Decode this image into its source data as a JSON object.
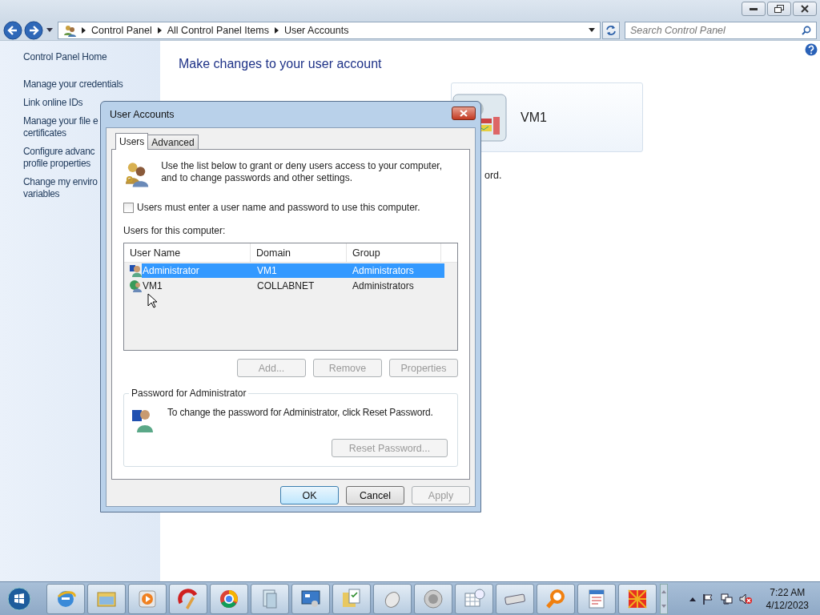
{
  "address_bar": {
    "breadcrumbs": [
      "Control Panel",
      "All Control Panel Items",
      "User Accounts"
    ]
  },
  "search": {
    "placeholder": "Search Control Panel"
  },
  "sidebar": {
    "home": "Control Panel Home",
    "links": [
      {
        "lines": [
          "Manage your credentials"
        ]
      },
      {
        "lines": [
          "Link online IDs"
        ]
      },
      {
        "lines": [
          "Manage your file e",
          "certificates"
        ]
      },
      {
        "lines": [
          "Configure advanc",
          "profile properties"
        ]
      },
      {
        "lines": [
          "Change my enviro",
          "variables"
        ]
      }
    ]
  },
  "content": {
    "heading": "Make changes to your user account",
    "account_name": "VM1",
    "fragment": "ord."
  },
  "dialog": {
    "title": "User Accounts",
    "tabs": [
      {
        "label": "Users",
        "selected": true
      },
      {
        "label": "Advanced",
        "selected": false
      }
    ],
    "intro": "Use the list below to grant or deny users access to your computer, and to change passwords and other settings.",
    "require_login": {
      "label": "Users must enter a user name and password to use this computer.",
      "checked": false
    },
    "list_label": "Users for this computer:",
    "table": {
      "columns": [
        "User Name",
        "Domain",
        "Group"
      ],
      "rows": [
        {
          "cells": [
            "Administrator",
            "VM1",
            "Administrators"
          ],
          "selected": true
        },
        {
          "cells": [
            "VM1",
            "COLLABNET",
            "Administrators"
          ],
          "selected": false
        }
      ]
    },
    "list_buttons": [
      {
        "label": "Add...",
        "disabled": true
      },
      {
        "label": "Remove",
        "disabled": true
      },
      {
        "label": "Properties",
        "disabled": true
      }
    ],
    "password_group": {
      "title": "Password for Administrator",
      "text": "To change the password for Administrator, click Reset Password.",
      "button": {
        "label": "Reset Password...",
        "disabled": true
      }
    },
    "buttons": [
      {
        "label": "OK",
        "disabled": false
      },
      {
        "label": "Cancel",
        "disabled": false
      },
      {
        "label": "Apply",
        "disabled": true
      }
    ]
  },
  "clock": {
    "time": "7:22 AM",
    "date": "4/12/2023"
  }
}
